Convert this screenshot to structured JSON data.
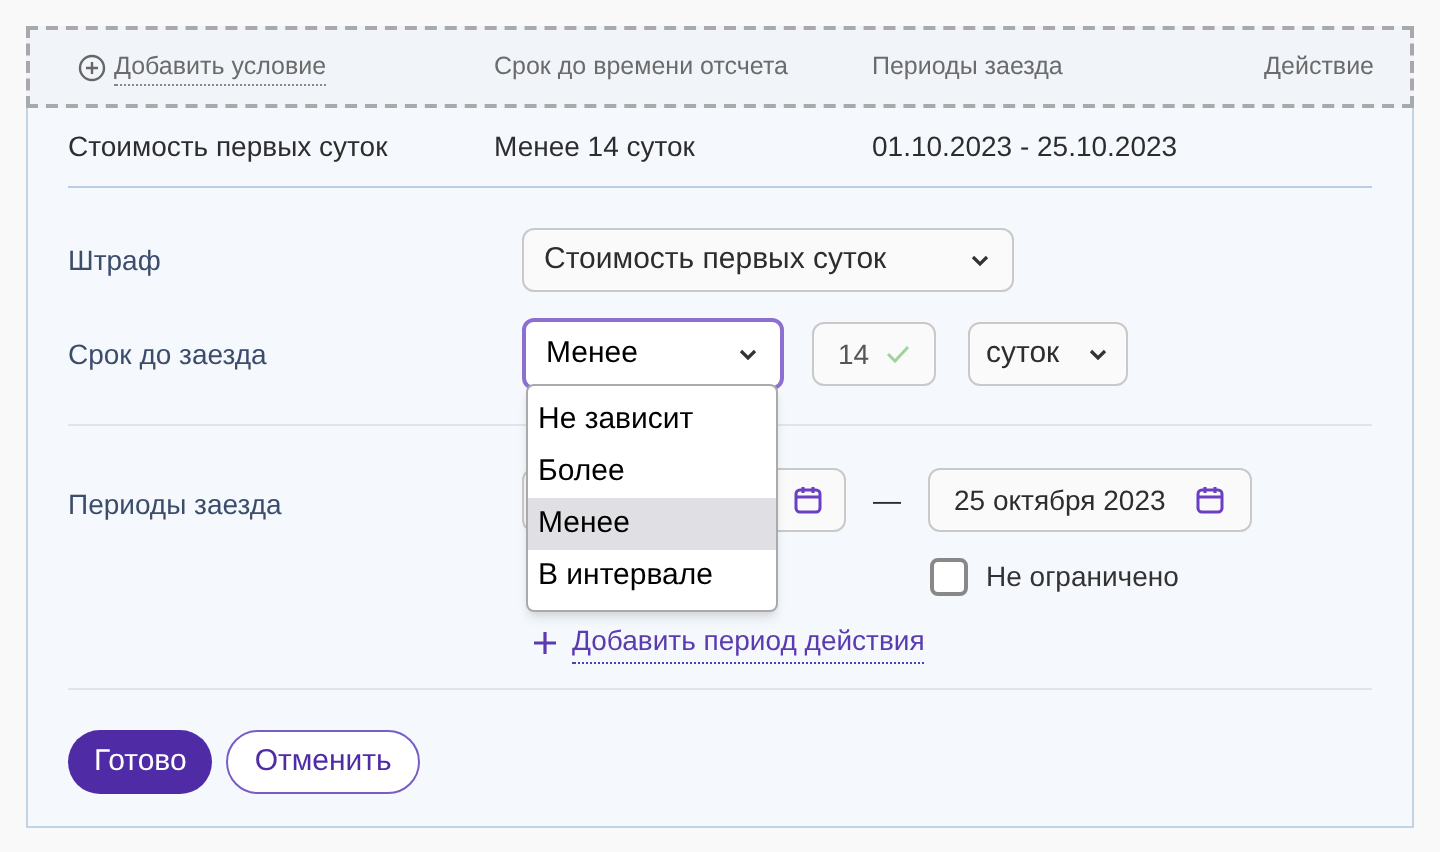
{
  "table": {
    "columns": [
      {
        "kind": "add",
        "label": "Добавить условие"
      },
      {
        "kind": "text",
        "label": "Срок до времени отсчета"
      },
      {
        "kind": "text",
        "label": "Периоды заезда"
      },
      {
        "kind": "text",
        "label": "Действие"
      }
    ],
    "rows": [
      {
        "cells": [
          "Стоимость первых суток",
          "Менее 14 суток",
          "01.10.2023 - 25.10.2023"
        ]
      }
    ]
  },
  "form": {
    "penalty": {
      "label": "Штраф",
      "value": "Стоимость первых суток"
    },
    "deadline": {
      "label": "Срок до заезда",
      "condition": "Менее",
      "amount": "14",
      "unit": "суток",
      "dropdown": {
        "options": [
          {
            "label": "Не зависит",
            "selected": false
          },
          {
            "label": "Более",
            "selected": false
          },
          {
            "label": "Менее",
            "selected": true
          },
          {
            "label": "В интервале",
            "selected": false
          }
        ]
      }
    },
    "periods": {
      "label": "Периоды заезда",
      "separator": "—",
      "end_date": "25 октября 2023",
      "unlimited": {
        "label": "Не ограничено",
        "checked": false
      },
      "add_link": "Добавить период действия"
    }
  },
  "buttons": [
    {
      "label": "Готово",
      "kind": "primary"
    },
    {
      "label": "Отменить",
      "kind": "secondary"
    }
  ]
}
